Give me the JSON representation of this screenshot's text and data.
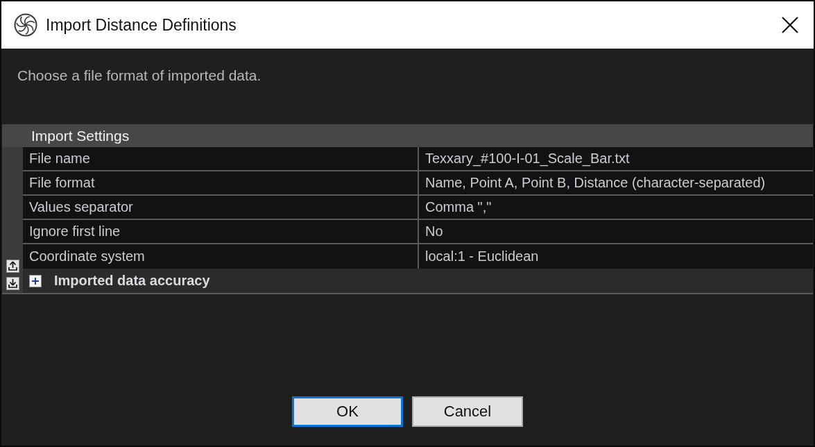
{
  "window": {
    "title": "Import Distance Definitions"
  },
  "description": "Choose a file format of imported data.",
  "property_grid": {
    "title": "Import Settings",
    "rows": [
      {
        "name": "File name",
        "value": "Texxary_#100-I-01_Scale_Bar.txt"
      },
      {
        "name": "File format",
        "value": "Name, Point A, Point B, Distance (character-separated)"
      },
      {
        "name": "Values separator",
        "value": "Comma \",\""
      },
      {
        "name": "Ignore first line",
        "value": "No"
      },
      {
        "name": "Coordinate system",
        "value": "local:1 - Euclidean"
      }
    ],
    "groups": [
      {
        "title": "Imported data accuracy",
        "expanded": false
      }
    ]
  },
  "buttons": [
    {
      "label": "OK",
      "default": true
    },
    {
      "label": "Cancel",
      "default": false
    }
  ]
}
